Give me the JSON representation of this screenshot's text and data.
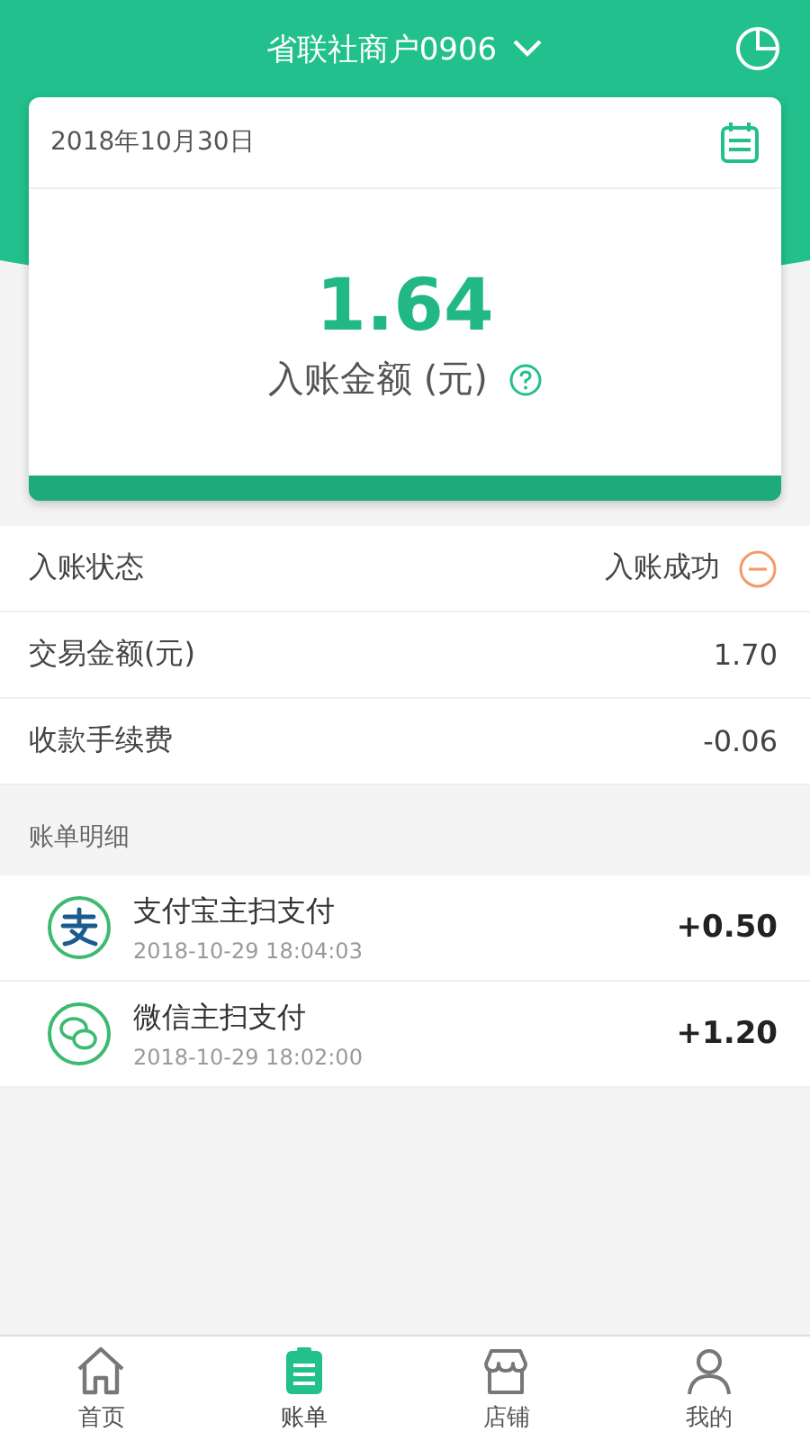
{
  "header": {
    "title": "省联社商户0906"
  },
  "summary": {
    "date": "2018年10月30日",
    "amount": "1.64",
    "label": "入账金额 (元)"
  },
  "details": [
    {
      "kind": "status",
      "label": "入账状态",
      "value": "入账成功"
    },
    {
      "kind": "plain",
      "label": "交易金额(元)",
      "value": "1.70"
    },
    {
      "kind": "plain",
      "label": "收款手续费",
      "value": "-0.06"
    }
  ],
  "section_title": "账单明细",
  "transactions": [
    {
      "kind": "alipay",
      "title": "支付宝主扫支付",
      "time": "2018-10-29 18:04:03",
      "amount": "+0.50"
    },
    {
      "kind": "wechat",
      "title": "微信主扫支付",
      "time": "2018-10-29 18:02:00",
      "amount": "+1.20"
    }
  ],
  "tabs": [
    {
      "kind": "home",
      "label": "首页",
      "selected": false
    },
    {
      "kind": "bill",
      "label": "账单",
      "selected": true
    },
    {
      "kind": "shop",
      "label": "店铺",
      "selected": false
    },
    {
      "kind": "me",
      "label": "我的",
      "selected": false
    }
  ]
}
